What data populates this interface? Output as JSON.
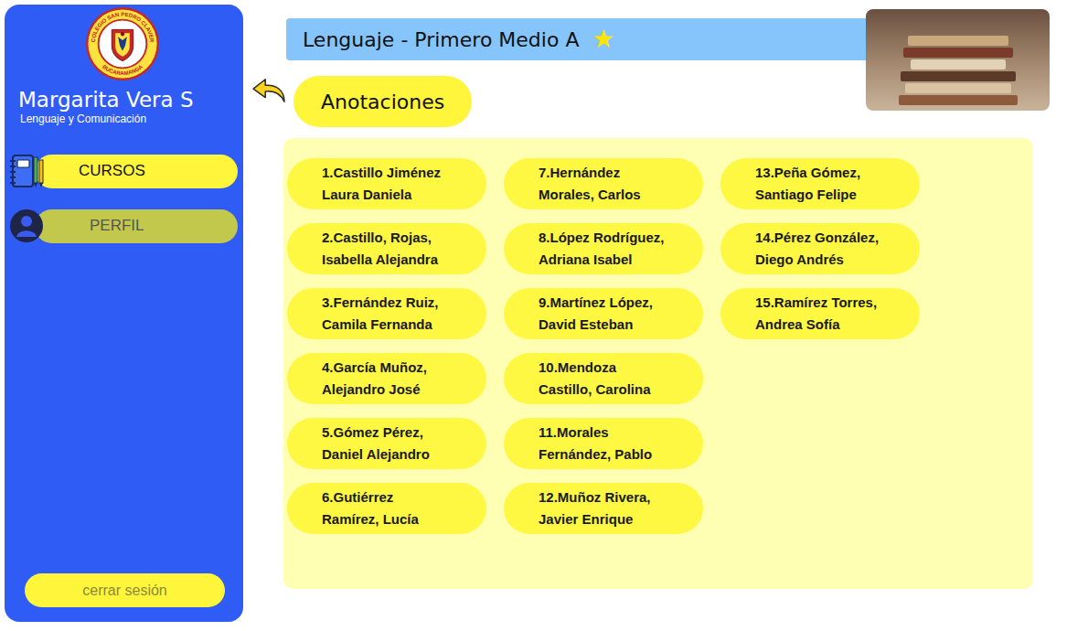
{
  "school_logo": {
    "top_text": "COLEGIO SAN PEDRO CLAVER",
    "bottom_text": "BUCARAMANGA"
  },
  "teacher": {
    "name": "Margarita Vera S",
    "subject": "Lenguaje y Comunicación"
  },
  "nav": [
    {
      "label": "CURSOS",
      "kind": "courses",
      "selected": true
    },
    {
      "label": "PERFIL",
      "kind": "profile",
      "selected": false
    }
  ],
  "logout": "cerrar sesión",
  "course_header": {
    "title": "Lenguaje - Primero Medio A",
    "starred": true,
    "star": "★"
  },
  "section_title": "Anotaciones",
  "students": [
    {
      "lines": [
        "1.Castillo Jiménez",
        "Laura Daniela"
      ]
    },
    {
      "lines": [
        "2.Castillo, Rojas,",
        "Isabella Alejandra"
      ]
    },
    {
      "lines": [
        "3.Fernández Ruiz,",
        "Camila Fernanda"
      ]
    },
    {
      "lines": [
        "4.García Muñoz,",
        "Alejandro José"
      ]
    },
    {
      "lines": [
        "5.Gómez Pérez,",
        "Daniel Alejandro"
      ]
    },
    {
      "lines": [
        "6.Gutiérrez",
        "Ramírez, Lucía"
      ]
    },
    {
      "lines": [
        "7.Hernández",
        "Morales, Carlos"
      ]
    },
    {
      "lines": [
        "8.López Rodríguez,",
        "Adriana Isabel"
      ]
    },
    {
      "lines": [
        "9.Martínez López,",
        "David Esteban"
      ]
    },
    {
      "lines": [
        "10.Mendoza",
        "Castillo, Carolina"
      ]
    },
    {
      "lines": [
        "11.Morales",
        "Fernández, Pablo"
      ]
    },
    {
      "lines": [
        "12.Muñoz Rivera,",
        "Javier Enrique"
      ]
    },
    {
      "lines": [
        "13.Peña Gómez,",
        "Santiago Felipe"
      ]
    },
    {
      "lines": [
        "14.Pérez González,",
        "Diego Andrés"
      ]
    },
    {
      "lines": [
        "15.Ramírez Torres,",
        "Andrea Sofía"
      ]
    }
  ]
}
